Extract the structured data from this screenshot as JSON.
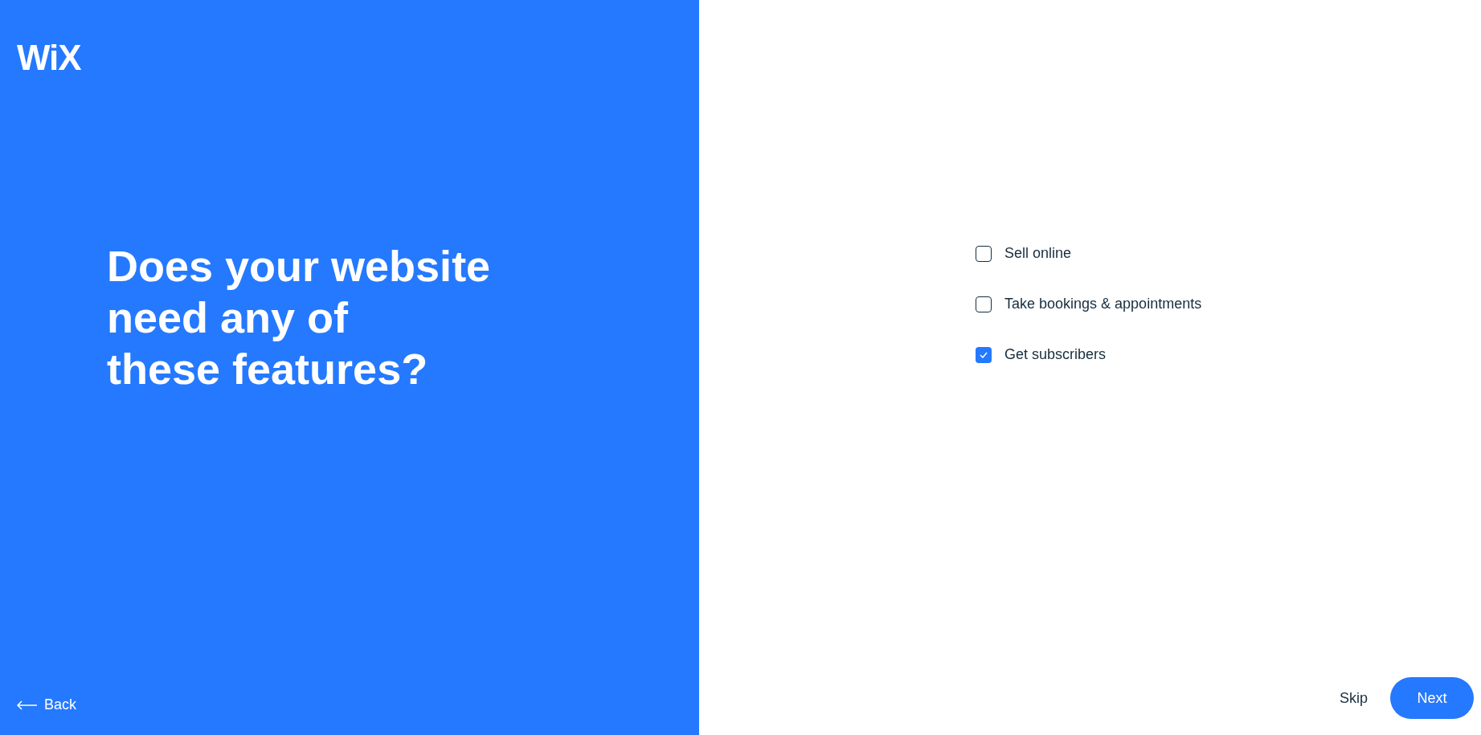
{
  "logo": "WiX",
  "heading": [
    "Does your website",
    "need any of",
    "these features?"
  ],
  "features": [
    {
      "label": "Sell online",
      "checked": false
    },
    {
      "label": "Take bookings & appointments",
      "checked": false
    },
    {
      "label": "Get subscribers",
      "checked": true
    }
  ],
  "back": "Back",
  "skip": "Skip",
  "next": "Next"
}
